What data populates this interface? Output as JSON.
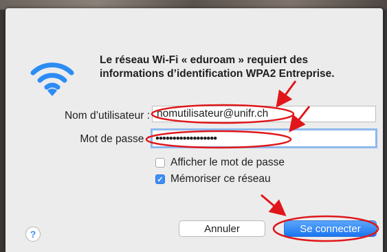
{
  "dialog": {
    "message": "Le réseau Wi-Fi « eduroam » requiert des informations d’identification WPA2 Entreprise.",
    "username_label": "Nom d’utilisateur :",
    "username_value": "nomutilisateur@unifr.ch",
    "password_label": "Mot de passe :",
    "password_value": "••••••••••••••••••",
    "show_password_label": "Afficher le mot de passe",
    "show_password_checked": false,
    "remember_label": "Mémoriser ce réseau",
    "remember_checked": true,
    "help_label": "?",
    "cancel_label": "Annuler",
    "connect_label": "Se connecter"
  },
  "icons": {
    "wifi": "wifi-icon",
    "help": "help-icon",
    "checkmark": "✓"
  },
  "colors": {
    "accent": "#1a75f0",
    "wifi_blue": "#2c8cf4",
    "annotation_red": "#e0161a",
    "focus_ring": "#8db8ee",
    "dialog_bg": "#ececec"
  }
}
